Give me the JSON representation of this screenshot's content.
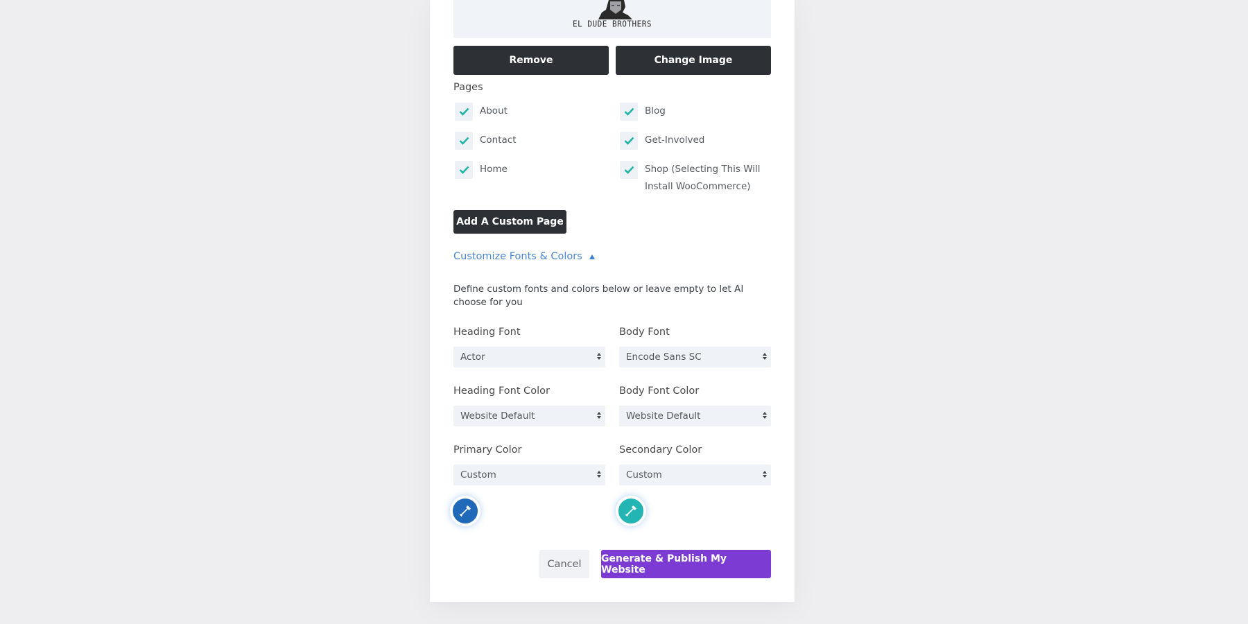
{
  "logo": {
    "caption": "EL DUDE BROTHERS",
    "alt": "logo-image"
  },
  "image_actions": {
    "remove_label": "Remove",
    "change_label": "Change Image"
  },
  "pages": {
    "label": "Pages",
    "items": [
      {
        "label": "About",
        "checked": true
      },
      {
        "label": "Blog",
        "checked": true
      },
      {
        "label": "Contact",
        "checked": true
      },
      {
        "label": "Get-Involved",
        "checked": true
      },
      {
        "label": "Home",
        "checked": true
      },
      {
        "label": "Shop (Selecting This Will Install WooCommerce)",
        "checked": true
      }
    ],
    "add_custom_label": "Add A Custom Page"
  },
  "customize": {
    "toggle_label": "Customize Fonts & Colors",
    "expanded": true,
    "description": "Define custom fonts and colors below or leave empty to let AI choose for you",
    "fields": {
      "heading_font": {
        "label": "Heading Font",
        "value": "Actor"
      },
      "body_font": {
        "label": "Body Font",
        "value": "Encode Sans SC"
      },
      "heading_font_color": {
        "label": "Heading Font Color",
        "value": "Website Default"
      },
      "body_font_color": {
        "label": "Body Font Color",
        "value": "Website Default"
      },
      "primary_color": {
        "label": "Primary Color",
        "value": "Custom",
        "swatch": "#2069b8"
      },
      "secondary_color": {
        "label": "Secondary Color",
        "value": "Custom",
        "swatch": "#23b4b4"
      }
    }
  },
  "footer": {
    "cancel_label": "Cancel",
    "generate_label": "Generate & Publish My Website"
  },
  "colors": {
    "accent_link": "#4a87d4",
    "check": "#1fb5a6",
    "primary_button": "#7c3bd2",
    "dark_button": "#2d3135"
  }
}
